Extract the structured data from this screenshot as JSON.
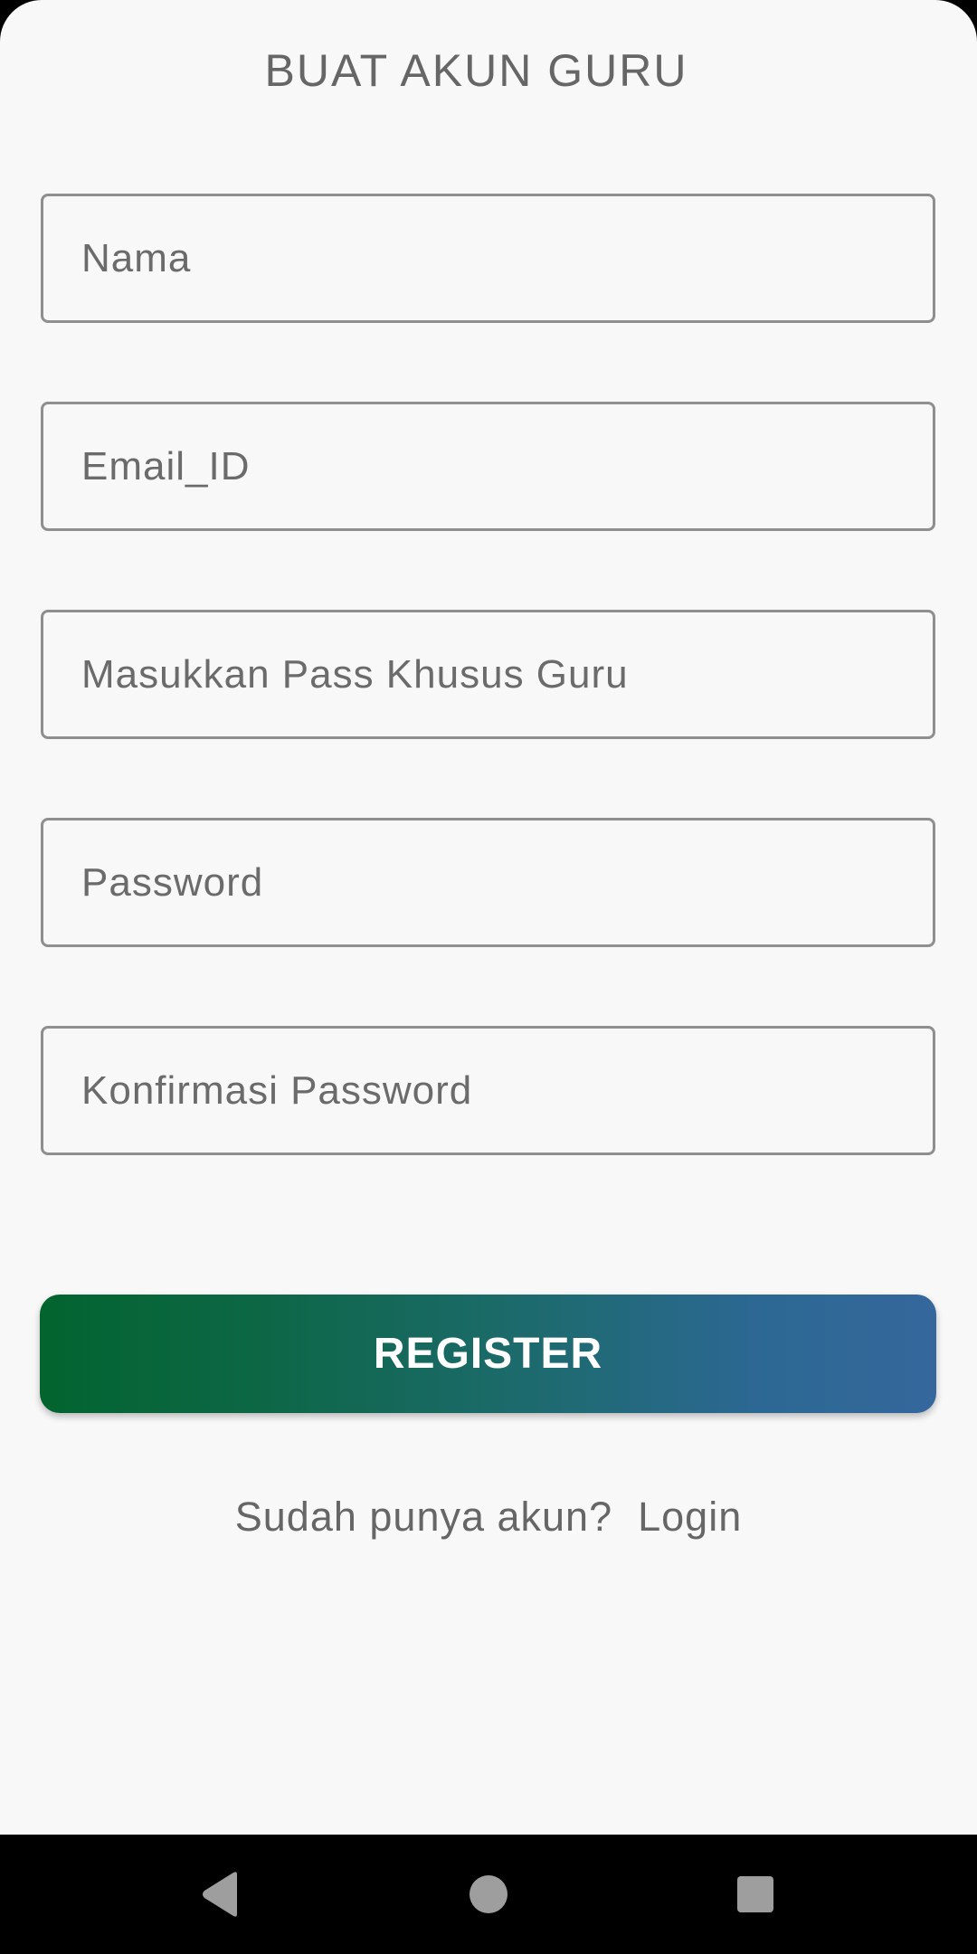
{
  "page": {
    "title": "BUAT AKUN GURU"
  },
  "form": {
    "name_placeholder": "Nama",
    "email_placeholder": "Email_ID",
    "teacher_pass_placeholder": "Masukkan Pass Khusus Guru",
    "password_placeholder": "Password",
    "confirm_password_placeholder": "Konfirmasi Password",
    "name_value": "",
    "email_value": "",
    "teacher_pass_value": "",
    "password_value": "",
    "confirm_password_value": ""
  },
  "actions": {
    "register_label": "REGISTER",
    "have_account_text": "Sudah punya akun?",
    "login_label": "Login"
  },
  "colors": {
    "background": "#f8f8f8",
    "text": "#666666",
    "field_border": "#8f8f8f",
    "button_gradient_start": "#03642f",
    "button_gradient_end": "#35679c",
    "nav_bar": "#000000",
    "nav_icon": "#9e9e9e"
  },
  "nav": {
    "back_icon": "back-triangle-icon",
    "home_icon": "home-circle-icon",
    "recents_icon": "recents-square-icon"
  }
}
